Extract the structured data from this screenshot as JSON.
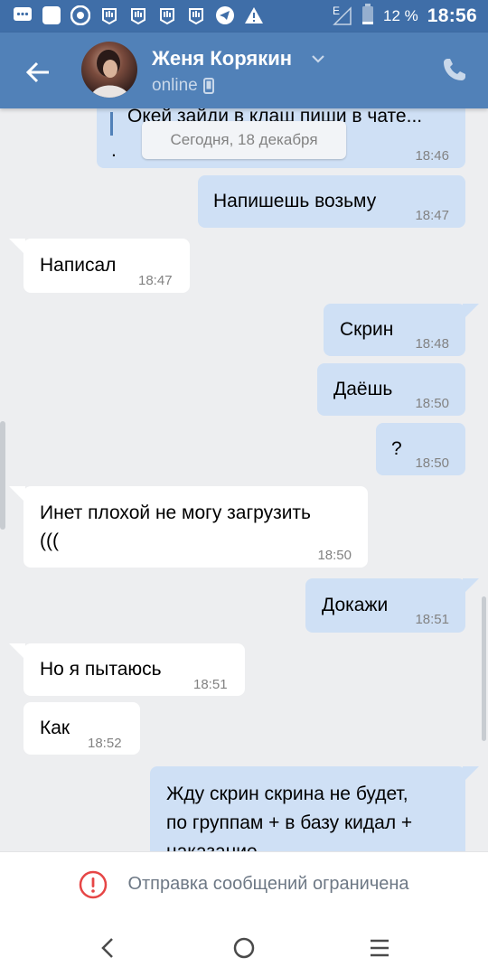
{
  "status_bar": {
    "battery_percent": "12 %",
    "time": "18:56",
    "network_letter": "E"
  },
  "header": {
    "contact_name": "Женя Корякин",
    "status": "online"
  },
  "chat": {
    "partial_quote": "Окей зайди в клаш пиши в чате...",
    "partial_dot": ".",
    "partial_time": "18:46",
    "date_separator": "Сегодня, 18 декабря",
    "messages": [
      {
        "dir": "out",
        "text": "Напишешь возьму",
        "time": "18:47"
      },
      {
        "dir": "in",
        "text": "Написал",
        "time": "18:47"
      },
      {
        "dir": "out",
        "text": "Скрин",
        "time": "18:48"
      },
      {
        "dir": "out",
        "text": "Даёшь",
        "time": "18:50"
      },
      {
        "dir": "out",
        "text": "?",
        "time": "18:50"
      },
      {
        "dir": "in",
        "text_line1": "Инет плохой не могу загрузить",
        "text_line2": "(((",
        "time": "18:50"
      },
      {
        "dir": "out",
        "text": "Докажи",
        "time": "18:51"
      },
      {
        "dir": "in",
        "text": "Но я пытаюсь",
        "time": "18:51"
      },
      {
        "dir": "in",
        "text": "Как",
        "time": "18:52"
      },
      {
        "dir": "out",
        "text_line1": "Жду скрин скрина не будет,",
        "text_line2": "по группам + в базу кидал +",
        "text_line3": "наказание"
      }
    ]
  },
  "footer": {
    "restricted_text": "Отправка сообщений ограничена"
  },
  "colors": {
    "status_bar": "#3f6ea8",
    "header": "#5181b8",
    "outgoing_bubble": "#cfe0f5",
    "incoming_bubble": "#ffffff",
    "background": "#edeef0",
    "warning": "#e64646"
  }
}
